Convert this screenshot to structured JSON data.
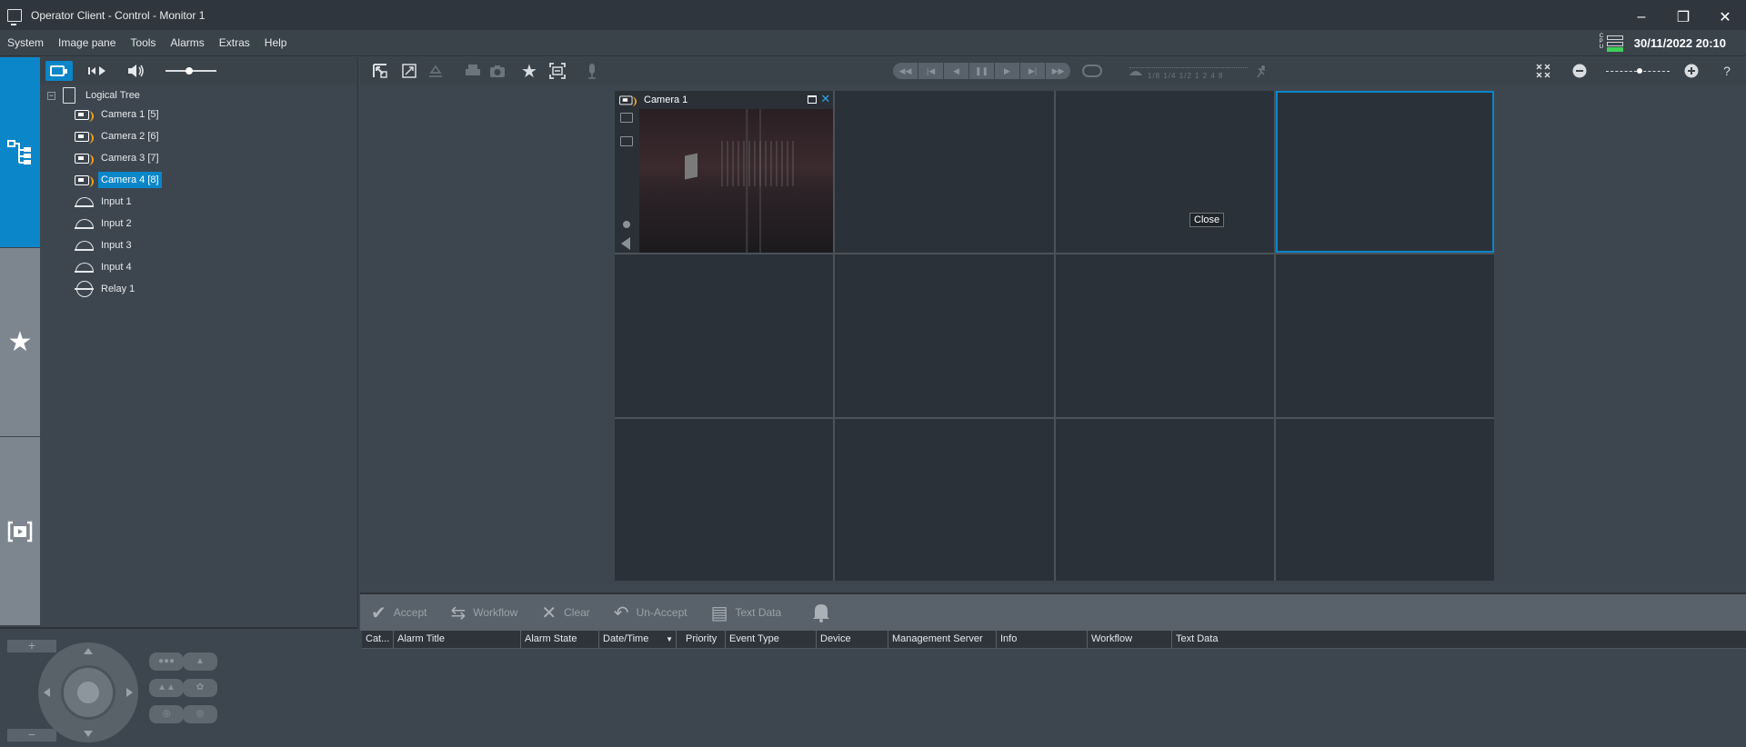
{
  "window": {
    "title": "Operator Client - Control - Monitor 1",
    "minimize": "–",
    "restore": "❐",
    "close": "✕"
  },
  "menu": {
    "items": [
      "System",
      "Image pane",
      "Tools",
      "Alarms",
      "Extras",
      "Help"
    ],
    "cpu_label": "CPU",
    "datetime": "30/11/2022 20:10"
  },
  "tree": {
    "root": "Logical Tree",
    "collapse_symbol": "−",
    "items": [
      {
        "label": "Camera 1 [5]",
        "type": "camera"
      },
      {
        "label": "Camera 2 [6]",
        "type": "camera"
      },
      {
        "label": "Camera 3 [7]",
        "type": "camera"
      },
      {
        "label": "Camera 4 [8]",
        "type": "camera",
        "selected": true
      },
      {
        "label": "Input 1",
        "type": "input"
      },
      {
        "label": "Input 2",
        "type": "input"
      },
      {
        "label": "Input 3",
        "type": "input"
      },
      {
        "label": "Input 4",
        "type": "input"
      },
      {
        "label": "Relay 1",
        "type": "relay"
      }
    ]
  },
  "main_toolbar": {
    "speed_labels": "1/8 1/4 1/2  1   2   4   8"
  },
  "video": {
    "pane_title": "Camera 1",
    "tooltip": "Close",
    "close_glyph": "✕"
  },
  "alarm_toolbar": {
    "accept": "Accept",
    "workflow": "Workflow",
    "clear": "Clear",
    "unaccept": "Un-Accept",
    "text_data": "Text Data"
  },
  "alarm_columns": [
    "Cat...",
    "Alarm Title",
    "Alarm State",
    "Date/Time",
    "Priority",
    "Event Type",
    "Device",
    "Management Server",
    "Info",
    "Workflow",
    "Text Data"
  ],
  "colors": {
    "accent": "#0a86c9",
    "camera_lens": "#f2a31a",
    "cpu_ok": "#3fcf59"
  }
}
